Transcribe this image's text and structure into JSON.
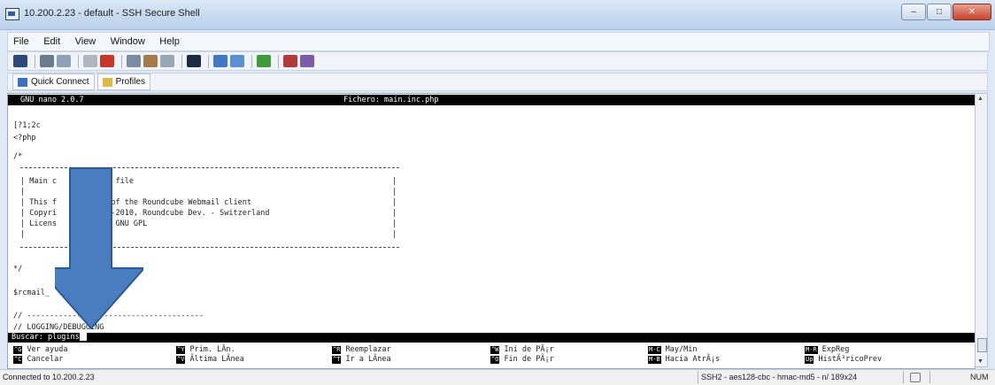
{
  "window": {
    "title": "10.200.2.23 - default - SSH Secure Shell",
    "buttons": {
      "minimize": "–",
      "maximize": "□",
      "close": "✕"
    }
  },
  "menu": [
    "File",
    "Edit",
    "View",
    "Window",
    "Help"
  ],
  "toolbar": {
    "icons": [
      "save-icon",
      "print-icon",
      "print-preview-icon",
      "cut-icon",
      "delete-icon",
      "copy-icon",
      "paste-icon",
      "paste-special-icon",
      "find-icon",
      "connect-icon",
      "disconnect-icon",
      "settings-icon",
      "file-transfer-icon",
      "help-icon"
    ]
  },
  "quickbar": {
    "quick_connect": "Quick Connect",
    "profiles": "Profiles"
  },
  "terminal": {
    "header": {
      "version": "GNU nano 2.0.7",
      "file": "Fichero: main.inc.php"
    },
    "lines": [
      "[?1;2c",
      "<?php",
      "/*",
      "| Main c          on file",
      "|",
      "| This f          t of the Roundcube Webmail client",
      "| Copyri          05-2010, Roundcube Dev. - Switzerland",
      "| Licens          he GNU GPL",
      "|",
      "*/",
      "$rcmail_         y();",
      "// ---------------------------------------",
      "// LOGGING/DEBUGGING"
    ],
    "search_prompt": "Buscar: plugins",
    "shortcuts": [
      {
        "key": "^G",
        "label": "Ver ayuda"
      },
      {
        "key": "^C",
        "label": "Cancelar"
      },
      {
        "key": "^Y",
        "label": "Prim. LÃ­n."
      },
      {
        "key": "^V",
        "label": "Ãltima LÃ­nea"
      },
      {
        "key": "^R",
        "label": "Reemplazar"
      },
      {
        "key": "^T",
        "label": "Ir a LÃ­nea"
      },
      {
        "key": "^W",
        "label": "Ini de PÃ¡r"
      },
      {
        "key": "^O",
        "label": "Fin de PÃ¡r"
      },
      {
        "key": "M-C",
        "label": "May/Min"
      },
      {
        "key": "M-B",
        "label": "Hacia AtrÃ¡s"
      },
      {
        "key": "M-R",
        "label": "ExpReg"
      },
      {
        "key": "Up",
        "label": "HistÃ³ricoPrev"
      }
    ]
  },
  "status": {
    "connection": "Connected to 10.200.2.23",
    "encryption": "SSH2 - aes128-cbc - hmac-md5 - n/ 189x24",
    "num": "NUM"
  },
  "colors": {
    "arrow": "#4a7cc0",
    "arrow_border": "#2c5a96",
    "terminal_bg": "#ffffff",
    "nano_bar": "#000000"
  }
}
